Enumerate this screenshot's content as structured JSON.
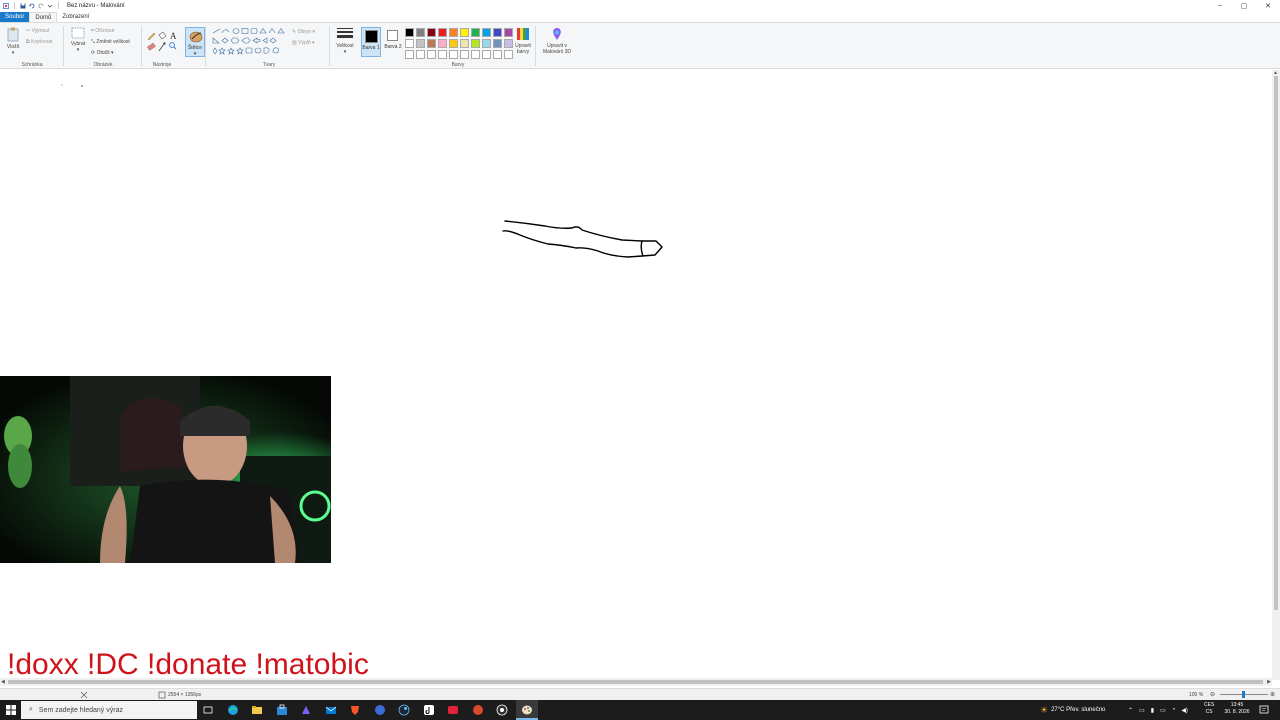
{
  "window": {
    "title": "Bez názvu - Malování",
    "minimize": "–",
    "maximize": "▢",
    "close": "✕"
  },
  "tabs": [
    "Soubor",
    "Domů",
    "Zobrazení"
  ],
  "ribbon": {
    "clipboard": {
      "paste": "Vložit",
      "cut": "Vyjmout",
      "copy": "Kopírovat",
      "label": "Schránka"
    },
    "image": {
      "select": "Vybrat",
      "crop": "Oříznout",
      "resize": "Změnit velikost",
      "rotate": "Otočit",
      "label": "Obrázek"
    },
    "tools": {
      "label": "Nástroje"
    },
    "brushes": {
      "label": "Štětce"
    },
    "shapes": {
      "outline": "Obrys",
      "fill": "Výplň",
      "label": "Tvary"
    },
    "size": {
      "label": "Velikost"
    },
    "color1": {
      "label": "Barva 1"
    },
    "color2": {
      "label": "Barva 2"
    },
    "colors": {
      "label": "Barvy"
    },
    "edit_colors": "Upravit barvy",
    "paint3d": "Upravit v Malování 3D"
  },
  "palette": {
    "row1": [
      "#000000",
      "#7f7f7f",
      "#880015",
      "#ed1c24",
      "#ff7f27",
      "#fff200",
      "#22b14c",
      "#00a2e8",
      "#3f48cc",
      "#a349a4"
    ],
    "row2": [
      "#ffffff",
      "#c3c3c3",
      "#b97a57",
      "#ffaec9",
      "#ffc90e",
      "#efe4b0",
      "#b5e61d",
      "#99d9ea",
      "#7092be",
      "#c8bfe7"
    ],
    "row3": [
      "#ffffff",
      "#ffffff",
      "#ffffff",
      "#ffffff",
      "#ffffff",
      "#ffffff",
      "#ffffff",
      "#ffffff",
      "#ffffff",
      "#ffffff"
    ]
  },
  "overlay": {
    "text": "!doxx  !DC !donate !matobic"
  },
  "status": {
    "dimensions": "2554 × 1356px",
    "zoom": "100 %"
  },
  "taskbar": {
    "search_placeholder": "Sem zadejte hledaný výraz",
    "weather": "27°C  Přev. slunečno",
    "lang1": "CES",
    "lang2": "CS",
    "time": "13:45",
    "date": "30. 8. 2026"
  }
}
